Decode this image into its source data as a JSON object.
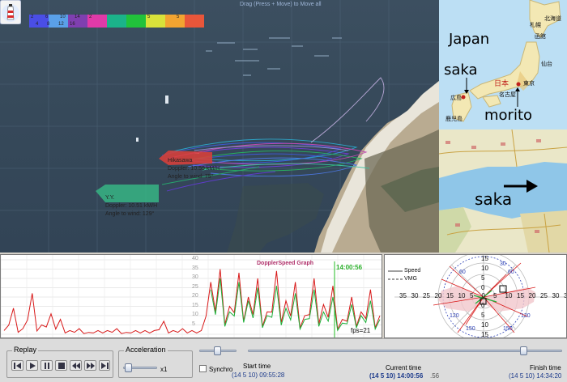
{
  "map": {
    "drag_hint": "Drag (Press + Move) to Move all",
    "scale_top_labels": [
      "2",
      "6",
      "10",
      "14",
      "2",
      "",
      "",
      "",
      "5",
      "",
      "5",
      ""
    ],
    "scale_bottom_labels": [
      "4",
      "8",
      "12",
      "16"
    ],
    "scale_colors": [
      "#4a4ee6",
      "#5aa0e8",
      "#7f3fb0",
      "#e03aa8",
      "#1bb38a",
      "#21c23b",
      "#d8e23a",
      "#f2a431",
      "#e9563a"
    ],
    "boat_1": {
      "name": "Hikasawa",
      "doppler": "Doppler: 10.59 kM/H",
      "angle": "Angle to wind: 75°"
    },
    "boat_2": {
      "name": "Y.Y.",
      "doppler": "Doppler: 10.51 kM/H",
      "angle": "Angle to wind: 129°"
    }
  },
  "japan_map": {
    "title": "Japan",
    "arrow_label_left": "saka",
    "arrow_label_right": "morito",
    "country": "日本",
    "cities": [
      {
        "name": "札幌"
      },
      {
        "name": "北海道"
      },
      {
        "name": "函館"
      },
      {
        "name": "仙台"
      },
      {
        "name": "東京"
      },
      {
        "name": "名古屋"
      },
      {
        "name": "広島"
      },
      {
        "name": "鹿児島"
      }
    ]
  },
  "region_map": {
    "label": "saka"
  },
  "graph": {
    "title": "DopplerSpeed Graph",
    "current_time": "14:00:56",
    "fps": "fps=21",
    "y_ticks": [
      "40",
      "35",
      "30",
      "25",
      "20",
      "15",
      "10",
      "5"
    ]
  },
  "polar": {
    "legend_speed": "Speed",
    "legend_vmg": "VMG",
    "ring_labels_top": [
      "15",
      "10",
      "5",
      "0"
    ],
    "ring_labels_row": [
      "35",
      "30",
      "25",
      "20",
      "15",
      "10",
      "5",
      "0",
      "5",
      "10",
      "15",
      "20",
      "25",
      "30",
      "35"
    ],
    "ring_labels_bottom": [
      "0",
      "5",
      "10",
      "15"
    ],
    "deg_labels": [
      "60",
      "30",
      "60",
      "120",
      "150",
      "150",
      "120"
    ]
  },
  "controls": {
    "replay_label": "Replay",
    "acceleration_label": "Acceleration",
    "acceleration_value": "x1",
    "synchro_label": "Synchro",
    "start_label": "Start time",
    "start_value": "(14 5 10) 09:55:28",
    "current_label": "Current time",
    "current_value": "(14 5 10) 14:00:56",
    "current_extra": ".56",
    "finish_label": "Finish time",
    "finish_value": "(14 5 10) 14:34:20",
    "colors": {
      "accent": "#1e3c8c",
      "speed": "#d81818",
      "vmg": "#1fb03a"
    }
  },
  "chart_data": {
    "type": "line",
    "title": "DopplerSpeed Graph",
    "xlabel": "",
    "ylabel": "",
    "ylim": [
      0,
      40
    ],
    "series": [
      {
        "values": [
          2,
          14,
          3,
          22,
          5,
          11,
          8,
          2,
          3,
          1,
          2,
          2,
          3,
          1,
          2,
          2,
          2,
          7,
          2,
          3,
          2,
          2,
          28,
          35,
          15,
          33,
          20,
          30,
          12,
          34,
          18,
          28,
          10,
          30,
          16,
          26,
          8,
          20,
          12,
          24,
          10
        ]
      },
      {
        "values": [
          0,
          0,
          0,
          0,
          0,
          0,
          0,
          0,
          0,
          0,
          0,
          0,
          0,
          0,
          0,
          0,
          0,
          0,
          0,
          0,
          0,
          0,
          24,
          30,
          12,
          28,
          18,
          25,
          10,
          26,
          14,
          22,
          8,
          24,
          12,
          20,
          6,
          16,
          10,
          18,
          8
        ]
      }
    ]
  }
}
